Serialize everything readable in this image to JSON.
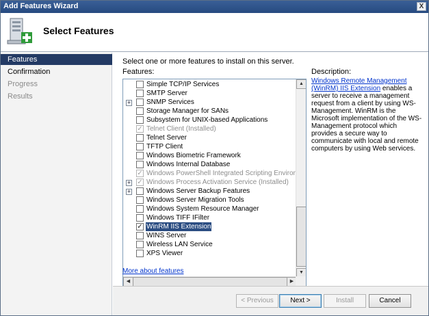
{
  "window": {
    "title": "Add Features Wizard",
    "close_label": "X"
  },
  "header": {
    "title": "Select Features"
  },
  "sidebar": {
    "items": [
      {
        "label": "Features",
        "state": "active"
      },
      {
        "label": "Confirmation",
        "state": "normal"
      },
      {
        "label": "Progress",
        "state": "disabled"
      },
      {
        "label": "Results",
        "state": "disabled"
      }
    ]
  },
  "main": {
    "instruction": "Select one or more features to install on this server.",
    "features_label": "Features:",
    "description_label": "Description:",
    "description_link": "Windows Remote Management (WinRM) IIS Extension",
    "description_text": " enables a server to receive a management request from a client by using WS-Management. WinRM is the Microsoft implementation of the WS-Management protocol which provides a secure way to communicate with local and remote computers by using Web services.",
    "more_link": "More about features"
  },
  "features": [
    {
      "label": "Simple TCP/IP Services",
      "checked": false,
      "grey": false,
      "expandable": false
    },
    {
      "label": "SMTP Server",
      "checked": false,
      "grey": false,
      "expandable": false
    },
    {
      "label": "SNMP Services",
      "checked": false,
      "grey": false,
      "expandable": true
    },
    {
      "label": "Storage Manager for SANs",
      "checked": false,
      "grey": false,
      "expandable": false
    },
    {
      "label": "Subsystem for UNIX-based Applications",
      "checked": false,
      "grey": false,
      "expandable": false
    },
    {
      "label": "Telnet Client  (Installed)",
      "checked": true,
      "grey": true,
      "expandable": false
    },
    {
      "label": "Telnet Server",
      "checked": false,
      "grey": false,
      "expandable": false
    },
    {
      "label": "TFTP Client",
      "checked": false,
      "grey": false,
      "expandable": false
    },
    {
      "label": "Windows Biometric Framework",
      "checked": false,
      "grey": false,
      "expandable": false
    },
    {
      "label": "Windows Internal Database",
      "checked": false,
      "grey": false,
      "expandable": false
    },
    {
      "label": "Windows PowerShell Integrated Scripting Environment (IS",
      "checked": true,
      "grey": true,
      "expandable": false
    },
    {
      "label": "Windows Process Activation Service  (Installed)",
      "checked": true,
      "grey": true,
      "expandable": true
    },
    {
      "label": "Windows Server Backup Features",
      "checked": false,
      "grey": false,
      "expandable": true
    },
    {
      "label": "Windows Server Migration Tools",
      "checked": false,
      "grey": false,
      "expandable": false
    },
    {
      "label": "Windows System Resource Manager",
      "checked": false,
      "grey": false,
      "expandable": false
    },
    {
      "label": "Windows TIFF IFilter",
      "checked": false,
      "grey": false,
      "expandable": false
    },
    {
      "label": "WinRM IIS Extension",
      "checked": true,
      "grey": false,
      "expandable": false,
      "selected": true
    },
    {
      "label": "WINS Server",
      "checked": false,
      "grey": false,
      "expandable": false
    },
    {
      "label": "Wireless LAN Service",
      "checked": false,
      "grey": false,
      "expandable": false
    },
    {
      "label": "XPS Viewer",
      "checked": false,
      "grey": false,
      "expandable": false
    }
  ],
  "icons": {
    "check": "✓",
    "plus": "+",
    "up": "▲",
    "down": "▼",
    "left": "◀",
    "right": "▶"
  },
  "buttons": {
    "previous": "< Previous",
    "next": "Next >",
    "install": "Install",
    "cancel": "Cancel"
  },
  "colors": {
    "title_bar": "#264a80",
    "nav_active": "#233a64",
    "link": "#0033cc",
    "selection": "#2b4d82"
  }
}
